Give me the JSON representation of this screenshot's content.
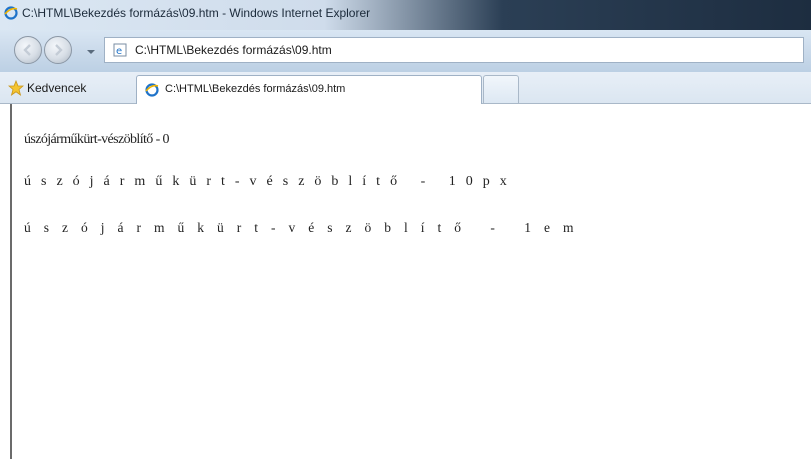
{
  "window": {
    "title": "C:\\HTML\\Bekezdés formázás\\09.htm - Windows Internet Explorer"
  },
  "navigation": {
    "address": "C:\\HTML\\Bekezdés formázás\\09.htm",
    "icons": [
      "back-icon",
      "forward-icon",
      "dropdown-arrow-icon",
      "ie-page-icon"
    ]
  },
  "favorites": {
    "label": "Kedvencek",
    "icon": "favorites-star-icon"
  },
  "tabs": [
    {
      "label": "C:\\HTML\\Bekezdés formázás\\09.htm",
      "icon": "ie-icon"
    }
  ],
  "content": {
    "paragraphs": [
      "úszójárműkürt-vészöblítő - 0",
      "úszójárműkürt-vészöblítő - 10px",
      "úszójárműkürt-vészöblítő - 1em"
    ]
  },
  "colors": {
    "titlebar_dark": "#1d2d40",
    "titlebar_light": "#dbe7f3",
    "toolbar_bg": "#c9d9ea",
    "text": "#222222"
  }
}
